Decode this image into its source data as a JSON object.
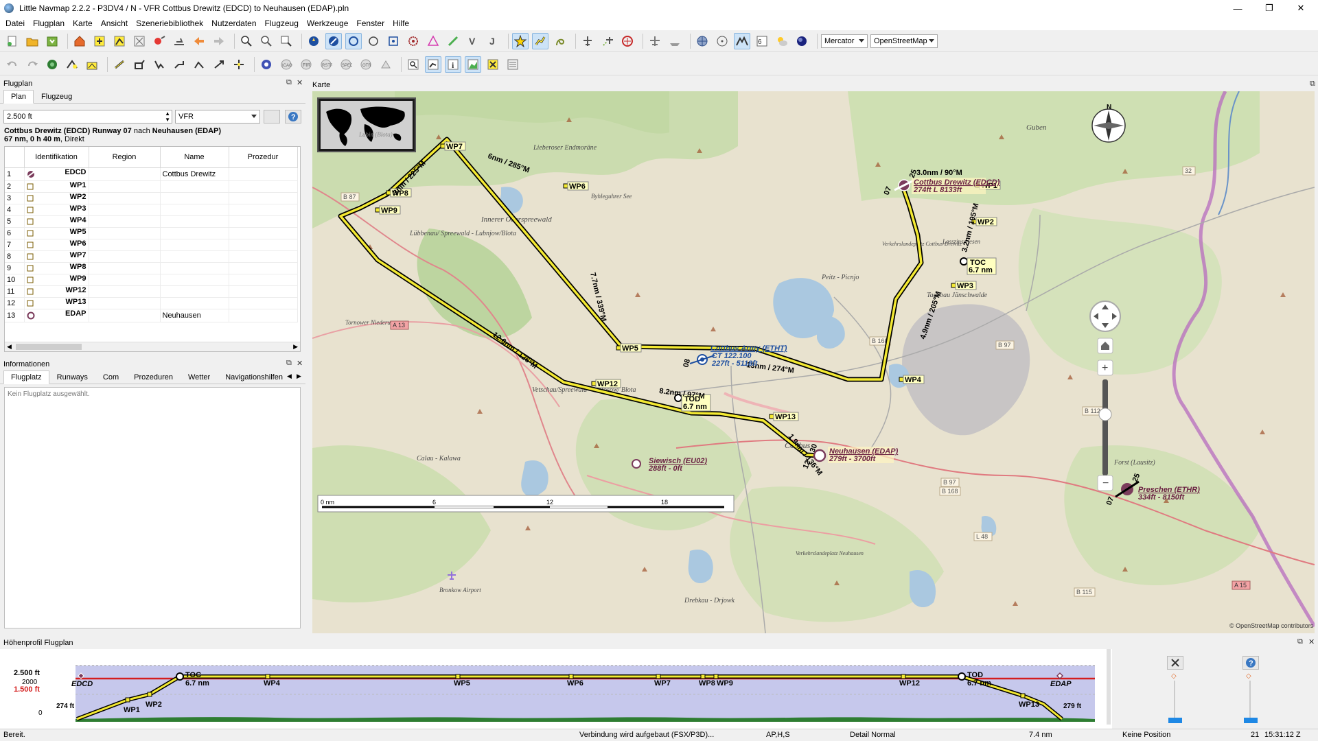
{
  "window": {
    "title": "Little Navmap 2.2.2 - P3DV4 / N - VFR Cottbus Drewitz (EDCD) to Neuhausen (EDAP).pln",
    "minimize": "—",
    "maximize": "❐",
    "close": "✕"
  },
  "menu": [
    "Datei",
    "Flugplan",
    "Karte",
    "Ansicht",
    "Szeneriebibliothek",
    "Nutzerdaten",
    "Flugzeug",
    "Werkzeuge",
    "Fenster",
    "Hilfe"
  ],
  "toolbar": {
    "projection": "Mercator",
    "theme": "OpenStreetMap"
  },
  "flightplan_dock": {
    "title": "Flugplan",
    "tabs": [
      "Plan",
      "Flugzeug"
    ],
    "altitude": "2.500 ft",
    "flight_type": "VFR",
    "route_line1_from": "Cottbus Drewitz (EDCD) Runway 07",
    "route_line1_mid": "nach",
    "route_line1_to": "Neuhausen (EDAP)",
    "route_line2_bold": "67 nm, 0 h 40 m",
    "route_line2_rest": ", Direkt",
    "columns": [
      "Identifikation",
      "Region",
      "Name",
      "Prozedur"
    ],
    "rows": [
      {
        "n": "1",
        "ident": "EDCD",
        "name": "Cottbus Drewitz",
        "sym": "airport"
      },
      {
        "n": "2",
        "ident": "WP1",
        "name": "",
        "sym": "wp"
      },
      {
        "n": "3",
        "ident": "WP2",
        "name": "",
        "sym": "wp"
      },
      {
        "n": "4",
        "ident": "WP3",
        "name": "",
        "sym": "wp"
      },
      {
        "n": "5",
        "ident": "WP4",
        "name": "",
        "sym": "wp"
      },
      {
        "n": "6",
        "ident": "WP5",
        "name": "",
        "sym": "wp"
      },
      {
        "n": "7",
        "ident": "WP6",
        "name": "",
        "sym": "wp"
      },
      {
        "n": "8",
        "ident": "WP7",
        "name": "",
        "sym": "wp"
      },
      {
        "n": "9",
        "ident": "WP8",
        "name": "",
        "sym": "wp"
      },
      {
        "n": "10",
        "ident": "WP9",
        "name": "",
        "sym": "wp"
      },
      {
        "n": "11",
        "ident": "WP12",
        "name": "",
        "sym": "wp"
      },
      {
        "n": "12",
        "ident": "WP13",
        "name": "",
        "sym": "wp"
      },
      {
        "n": "13",
        "ident": "EDAP",
        "name": "Neuhausen",
        "sym": "airport-open"
      }
    ]
  },
  "info_dock": {
    "title": "Informationen",
    "tabs": [
      "Flugplatz",
      "Runways",
      "Com",
      "Prozeduren",
      "Wetter",
      "Navigationshilfen"
    ],
    "empty_text": "Kein Flugplatz ausgewählt."
  },
  "map_dock": {
    "title": "Karte",
    "overview_label": "Lubin (Blota)",
    "attribution": "© OpenStreetMap contributors",
    "scale": [
      "0 nm",
      "6",
      "12",
      "18"
    ],
    "places": [
      "Guben",
      "Lieberoser Endmoräne",
      "Byhleguhrer See",
      "Innerer Oberspreewald",
      "Lübbenau/ Spreewald - Lubnjow/Blota",
      "Lasszinswiesen",
      "Peitz - Picnjo",
      "Tagebau Jänschwalde",
      "Tornower Niederung",
      "Vetschau/Spreewald - Wětošow/ Błota",
      "Calau - Kalawa",
      "Cottbus",
      "Forst (Lausitz)",
      "Drebkau - Drjowk",
      "Bronkow Airport",
      "Verkehrslandeplatz Neuhausen",
      "Verkehrslandeplatz Cottbus-Drewitz"
    ],
    "roads": [
      "B 87",
      "A 13",
      "B 168",
      "B 97",
      "B 112",
      "B 115",
      "A 15",
      "L 48",
      "B 97",
      "B 168",
      "32"
    ],
    "waypoints": [
      "WP1",
      "WP2",
      "WP3",
      "WP4",
      "WP5",
      "WP6",
      "WP7",
      "WP8",
      "WP9",
      "WP12",
      "WP13",
      "TOC",
      "TOD"
    ],
    "toc_dist": "6.7 nm",
    "tod_dist": "6.7 nm",
    "legs": [
      "3nm / 225°M",
      "6nm / 285°M",
      "7.7nm / 339°M",
      "12.6nm / 126°M",
      "8.2nm / 97°M",
      "1.9nm / 136°M",
      "13nm / 274°M",
      "4.9nm / 205°M",
      "3.2nm / 195°M",
      "3.0nm / 90°M"
    ],
    "airports": {
      "edcd": "Cottbus Drewitz (EDCD)",
      "edcd_info": "274ft L 8133ft",
      "etht": "Cottbus Army (ETHT)",
      "etht_freq": "CT 122.100",
      "etht_info": "227ft - 5118ft",
      "edap": "Neuhausen (EDAP)",
      "edap_info": "279ft - 3700ft",
      "eu02": "Siewisch (EU02)",
      "eu02_info": "288ft - 0ft",
      "ethr": "Preschen (ETHR)",
      "ethr_info": "334ft - 8150ft"
    },
    "runway_nums": [
      "07",
      "25",
      "07",
      "25",
      "12",
      "30",
      "08"
    ]
  },
  "profile": {
    "title": "Höhenprofil Flugplan",
    "alt_top": "2.500 ft",
    "alt_2000": "2000",
    "alt_1500": "1.500 ft",
    "alt_0": "0",
    "start_elev": "274 ft",
    "end_elev": "279 ft",
    "points": [
      "EDCD",
      "WP1",
      "WP2",
      "TOC",
      "WP4",
      "WP5",
      "WP6",
      "WP7",
      "WP8",
      "WP9",
      "WP12",
      "TOD",
      "WP13",
      "EDAP"
    ],
    "toc_dist": "6.7 nm",
    "tod_dist": "6.7 nm"
  },
  "status": {
    "ready": "Bereit.",
    "connection": "Verbindung wird aufgebaut (FSX/P3D)...",
    "flags": "AP,H,S",
    "detail": "Detail Normal",
    "distance": "7.4 nm",
    "position": "Keine Position",
    "day": "21",
    "time": "15:31:12 Z"
  }
}
